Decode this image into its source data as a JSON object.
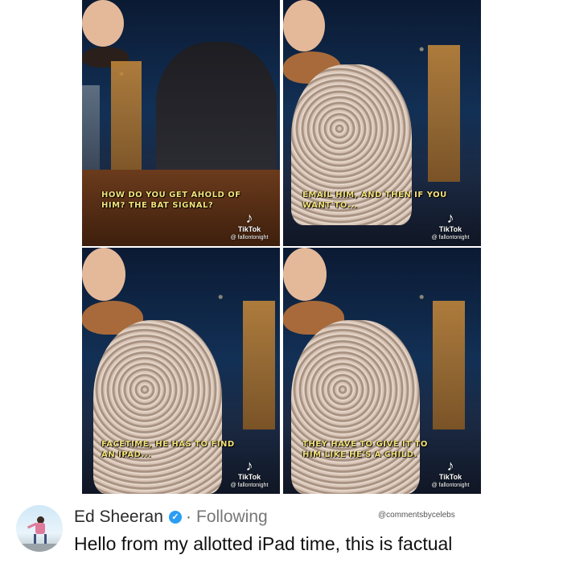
{
  "panels": [
    {
      "caption_line1": "HOW DO YOU GET AHOLD OF",
      "caption_line2": "HIM? THE BAT SIGNAL?",
      "badge": {
        "name": "TikTok",
        "handle": "@ fallontonight",
        "icon": "tiktok-icon"
      }
    },
    {
      "caption_line1": "EMAIL HIM, AND THEN IF YOU",
      "caption_line2": "WANT TO...",
      "badge": {
        "name": "TikTok",
        "handle": "@ fallontonight",
        "icon": "tiktok-icon"
      }
    },
    {
      "caption_line1": "FACETIME, HE HAS TO FIND",
      "caption_line2": "AN IPAD...",
      "badge": {
        "name": "TikTok",
        "handle": "@ fallontonight",
        "icon": "tiktok-icon"
      }
    },
    {
      "caption_line1": "THEY HAVE TO GIVE IT TO",
      "caption_line2": "HIM LIKE HE'S A CHILD.",
      "badge": {
        "name": "TikTok",
        "handle": "@ fallontonight",
        "icon": "tiktok-icon"
      }
    }
  ],
  "comment": {
    "username": "Ed Sheeran",
    "verified_icon": "verified-badge-icon",
    "separator": "·",
    "follow_status": "Following",
    "credit": "@commentsbycelebs",
    "text": "Hello from my allotted iPad time, this is factual"
  },
  "colors": {
    "caption": "#f4e27a",
    "verified": "#2a9df4"
  }
}
